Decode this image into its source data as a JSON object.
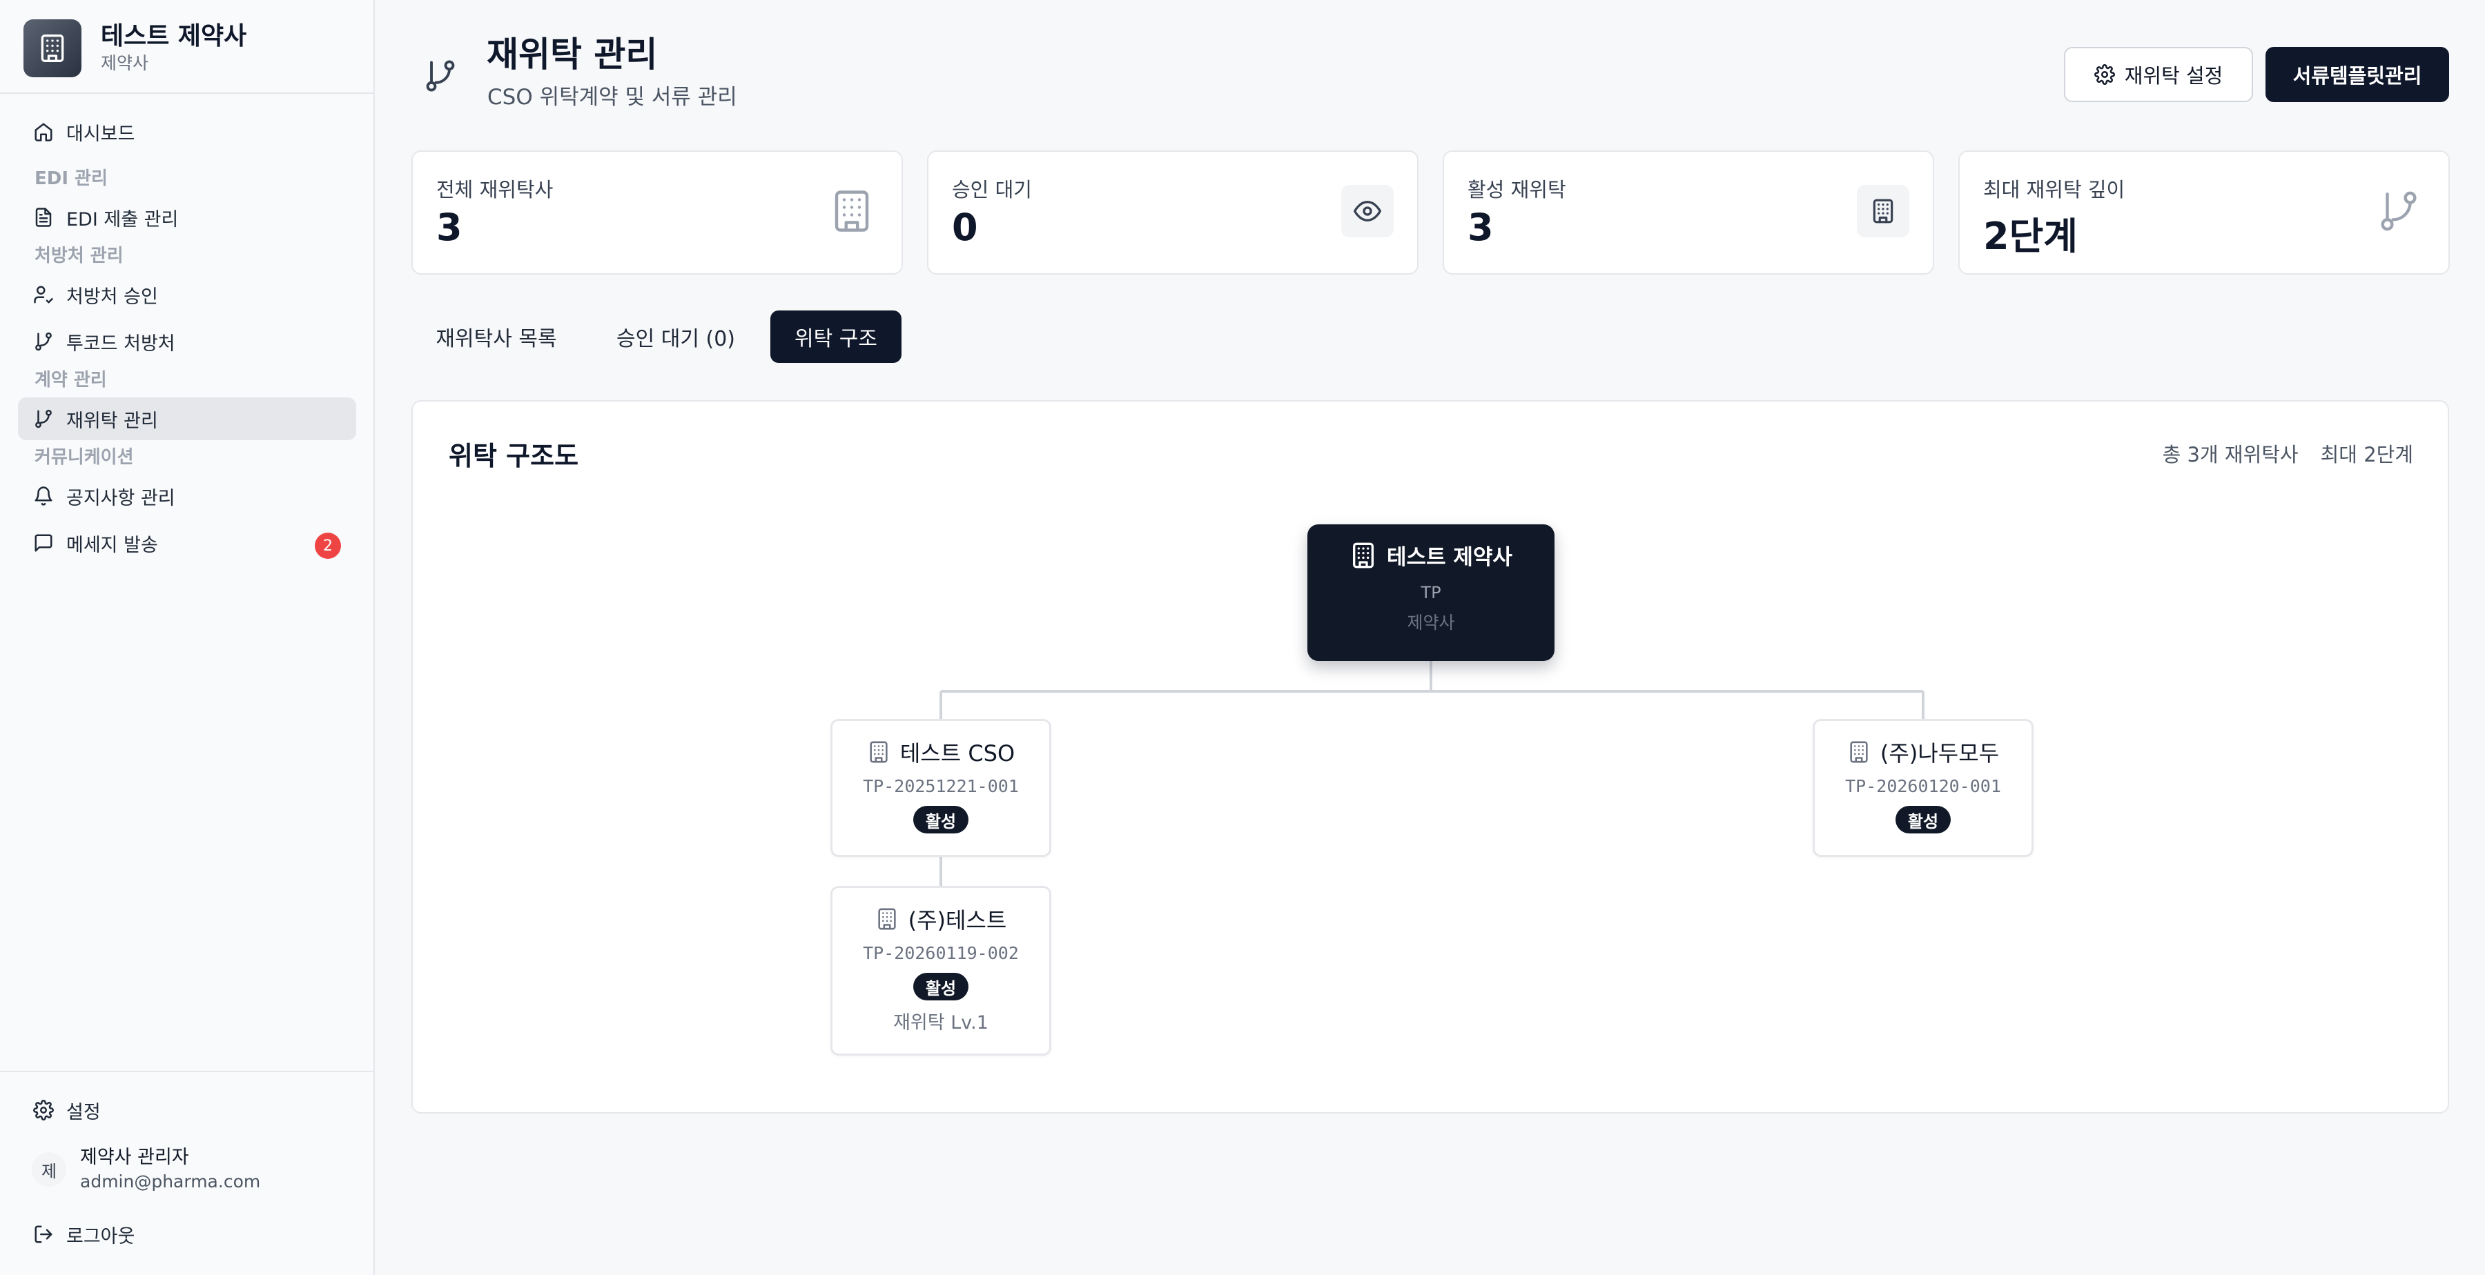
{
  "brand": {
    "name": "테스트 제약사",
    "subtitle": "제약사"
  },
  "nav": {
    "dashboard": "대시보드",
    "group_edi": "EDI 관리",
    "edi_submissions": "EDI 제출 관리",
    "group_prescriber": "처방처 관리",
    "prescriber_approval": "처방처 승인",
    "twocode_prescriber": "투코드 처방처",
    "group_contract": "계약 관리",
    "subcontract": "재위탁 관리",
    "group_comm": "커뮤니케이션",
    "notices": "공지사항 관리",
    "messages": "메세지 발송",
    "messages_badge": "2",
    "settings": "설정",
    "logout": "로그아웃"
  },
  "user": {
    "avatar_initial": "제",
    "name": "제약사 관리자",
    "email": "admin@pharma.com"
  },
  "header": {
    "title": "재위탁 관리",
    "subtitle": "CSO 위탁계약 및 서류 관리",
    "settings_button": "재위탁 설정",
    "template_button": "서류템플릿관리"
  },
  "stats": [
    {
      "label": "전체 재위탁사",
      "value": "3",
      "icon": "building-icon"
    },
    {
      "label": "승인 대기",
      "value": "0",
      "icon": "eye-icon"
    },
    {
      "label": "활성 재위탁",
      "value": "3",
      "icon": "building-icon"
    },
    {
      "label": "최대 재위탁 깊이",
      "value": "2단계",
      "icon": "git-branch-icon"
    }
  ],
  "tabs": [
    {
      "label": "재위탁사 목록",
      "active": false
    },
    {
      "label": "승인 대기 (0)",
      "active": false
    },
    {
      "label": "위탁 구조",
      "active": true
    }
  ],
  "tree": {
    "title": "위탁 구조도",
    "meta_total": "총 3개 재위탁사",
    "meta_depth": "최대 2단계",
    "root": {
      "name": "테스트 제약사",
      "code": "TP",
      "type": "제약사"
    },
    "children": [
      {
        "name": "테스트 CSO",
        "code": "TP-20251221-001",
        "status": "활성"
      },
      {
        "name": "(주)나두모두",
        "code": "TP-20260120-001",
        "status": "활성"
      }
    ],
    "grandchild": {
      "name": "(주)테스트",
      "code": "TP-20260119-002",
      "status": "활성",
      "level": "재위탁 Lv.1"
    }
  },
  "colors": {
    "primary": "#0f172a",
    "badge_red": "#ef4444",
    "muted": "#6b7280",
    "border": "#e5e7eb"
  }
}
